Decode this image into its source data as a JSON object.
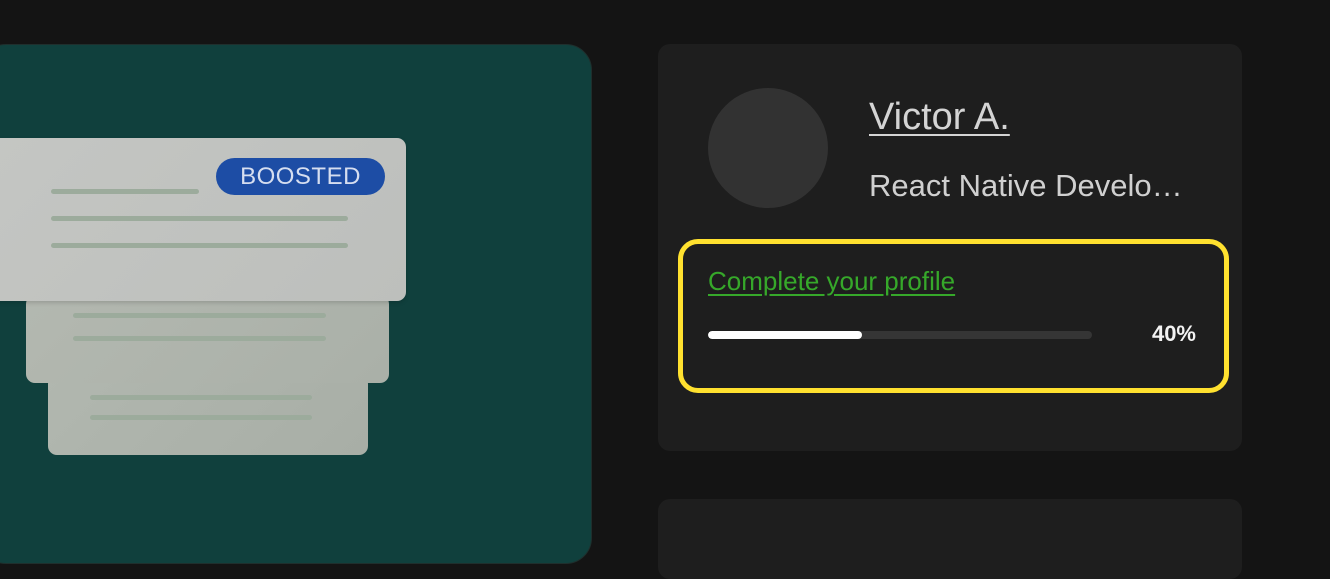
{
  "promo": {
    "badge_label": "BOOSTED"
  },
  "profile": {
    "name": "Victor A.",
    "title": "React Native Develo…",
    "completion": {
      "link_label": "Complete your profile",
      "progress_value": 0.4,
      "progress_label": "40%"
    }
  },
  "colors": {
    "page_background": "#141414",
    "promo_background": "#10403d",
    "card_background": "#1e1e1e",
    "badge_background": "#1d4da5",
    "highlight_border": "#ffe12f",
    "link_green": "#36a82a"
  }
}
